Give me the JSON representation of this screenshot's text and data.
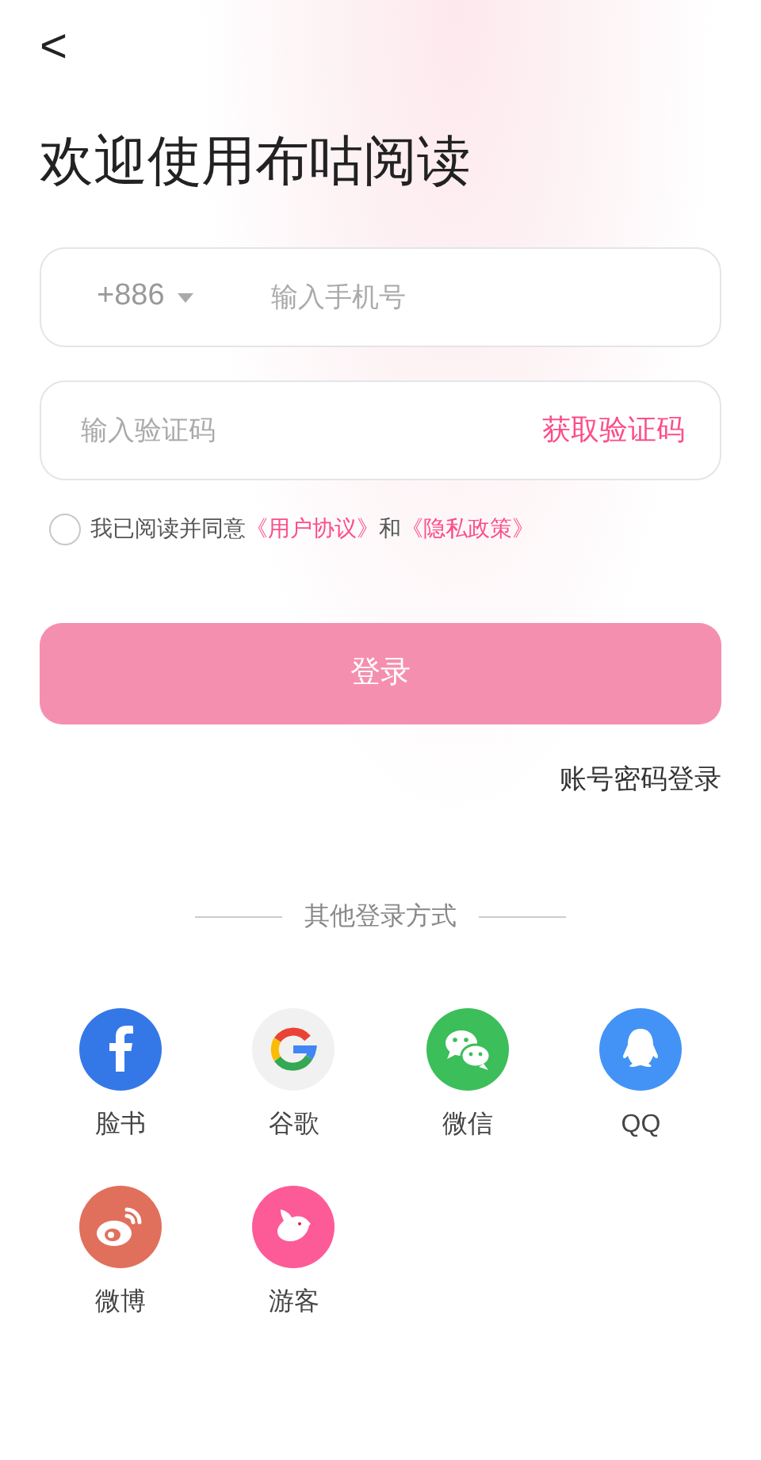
{
  "back_button": {
    "icon": "<"
  },
  "title": "欢迎使用布咕阅读",
  "phone_field": {
    "country_code": "+886",
    "placeholder": "输入手机号"
  },
  "code_field": {
    "placeholder": "输入验证码",
    "action": "获取验证码"
  },
  "agreement": {
    "checked": false,
    "parts": [
      {
        "kind": "text",
        "text": "我已阅读并同意"
      },
      {
        "kind": "link",
        "text": "《用户协议》"
      },
      {
        "kind": "text",
        "text": "和"
      },
      {
        "kind": "link",
        "text": "《隐私政策》"
      }
    ]
  },
  "login_button": {
    "label": "登录",
    "disabled": true
  },
  "password_login_link": "账号密码登录",
  "other_methods": {
    "heading": "其他登录方式",
    "items": [
      {
        "kind": "facebook",
        "label": "脸书"
      },
      {
        "kind": "google",
        "label": "谷歌"
      },
      {
        "kind": "wechat",
        "label": "微信"
      },
      {
        "kind": "qq",
        "label": "QQ"
      },
      {
        "kind": "weibo",
        "label": "微博"
      },
      {
        "kind": "guest",
        "label": "游客"
      }
    ]
  }
}
